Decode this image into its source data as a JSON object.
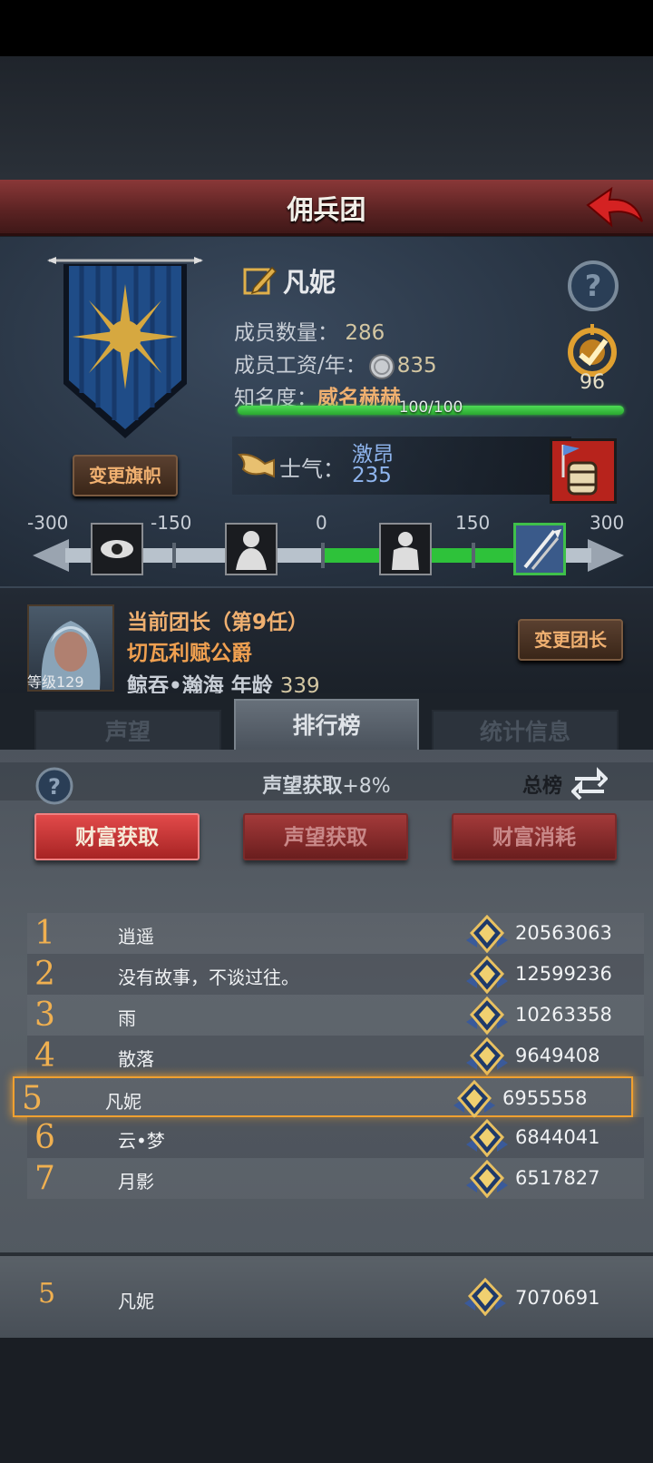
{
  "header": {
    "title": "佣兵团"
  },
  "guild": {
    "change_flag_label": "变更旗帜",
    "name": "凡妮",
    "members_label": "成员数量：",
    "members_value": "286",
    "wage_label": "成员工资/年：",
    "wage_value": "835",
    "fame_label": "知名度：",
    "fame_value": "威名赫赫",
    "fame_progress_text": "100/100",
    "fame_progress": 1.0,
    "badge_value": "96",
    "morale_label": "士气：",
    "morale_state": "激昂",
    "morale_value": "235",
    "scale_ticks": [
      "-300",
      "-150",
      "0",
      "150",
      "300"
    ]
  },
  "leader": {
    "title": "当前团长（第9任）",
    "name": "切瓦利赋公爵",
    "level_text": "等级129",
    "race": "鲸吞•瀚海",
    "age_label": "年龄",
    "age_value": "339",
    "change_leader_label": "变更团长"
  },
  "tabs": [
    {
      "label": "声望",
      "active": false
    },
    {
      "label": "排行榜",
      "active": true
    },
    {
      "label": "统计信息",
      "active": false
    }
  ],
  "ranking": {
    "bonus_label": "声望获取",
    "bonus_pct": "+8%",
    "total_label": "总榜",
    "categories": [
      {
        "label": "财富获取",
        "active": true
      },
      {
        "label": "声望获取",
        "active": false
      },
      {
        "label": "财富消耗",
        "active": false
      }
    ],
    "rows": [
      {
        "rank": "1",
        "name": "逍遥",
        "score": "20563063"
      },
      {
        "rank": "2",
        "name": "没有故事，不谈过往。",
        "score": "12599236"
      },
      {
        "rank": "3",
        "name": "雨",
        "score": "10263358"
      },
      {
        "rank": "4",
        "name": "散落",
        "score": "9649408"
      },
      {
        "rank": "5",
        "name": "凡妮",
        "score": "6955558"
      },
      {
        "rank": "6",
        "name": "云•梦",
        "score": "6844041"
      },
      {
        "rank": "7",
        "name": "月影",
        "score": "6517827"
      }
    ],
    "mine": {
      "rank": "5",
      "name": "凡妮",
      "score": "7070691"
    }
  },
  "colors": {
    "accent_gold": "#f0b050",
    "header_red": "#7a2e2e",
    "active_green": "#3fc04a"
  }
}
